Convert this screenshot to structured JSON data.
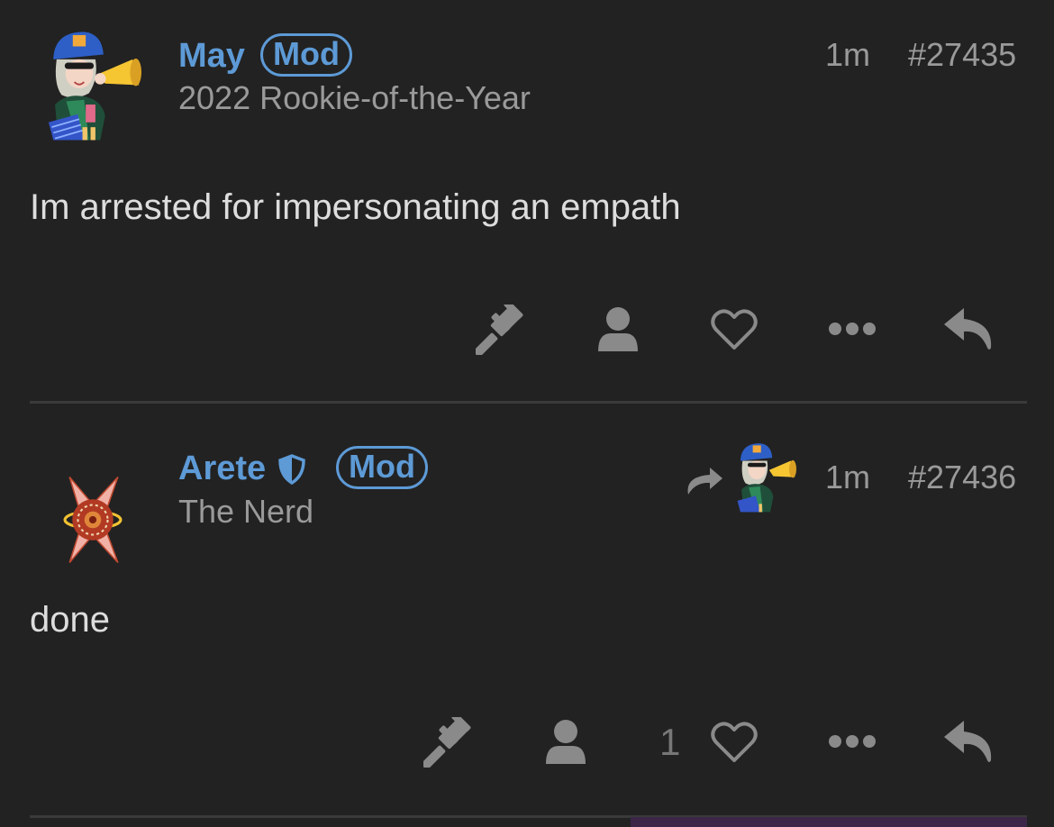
{
  "posts": [
    {
      "username": "May",
      "badge": "Mod",
      "user_title": "2022 Rookie-of-the-Year",
      "age": "1m",
      "post_number": "#27435",
      "content": "Im arrested for impersonating an empath",
      "like_count": "",
      "avatar": "megaphone-character-avatar"
    },
    {
      "username": "Arete",
      "badge": "Mod",
      "user_title": "The Nerd",
      "age": "1m",
      "post_number": "#27436",
      "content": "done",
      "like_count": "1",
      "avatar": "spiral-emblem-avatar",
      "reply_to_avatar": "megaphone-character-avatar"
    }
  ],
  "colors": {
    "background": "#222222",
    "accent": "#5d9ad6",
    "muted": "#9a9a9a",
    "icon": "#8a8a8a",
    "text": "#dddddd",
    "divider": "#3a3a3a"
  },
  "icons": {
    "flag": "gavel-icon",
    "user": "user-icon",
    "like": "heart-icon",
    "more": "ellipsis-icon",
    "reply": "reply-icon",
    "reply_indicator": "share-arrow-icon",
    "shield": "shield-icon"
  }
}
